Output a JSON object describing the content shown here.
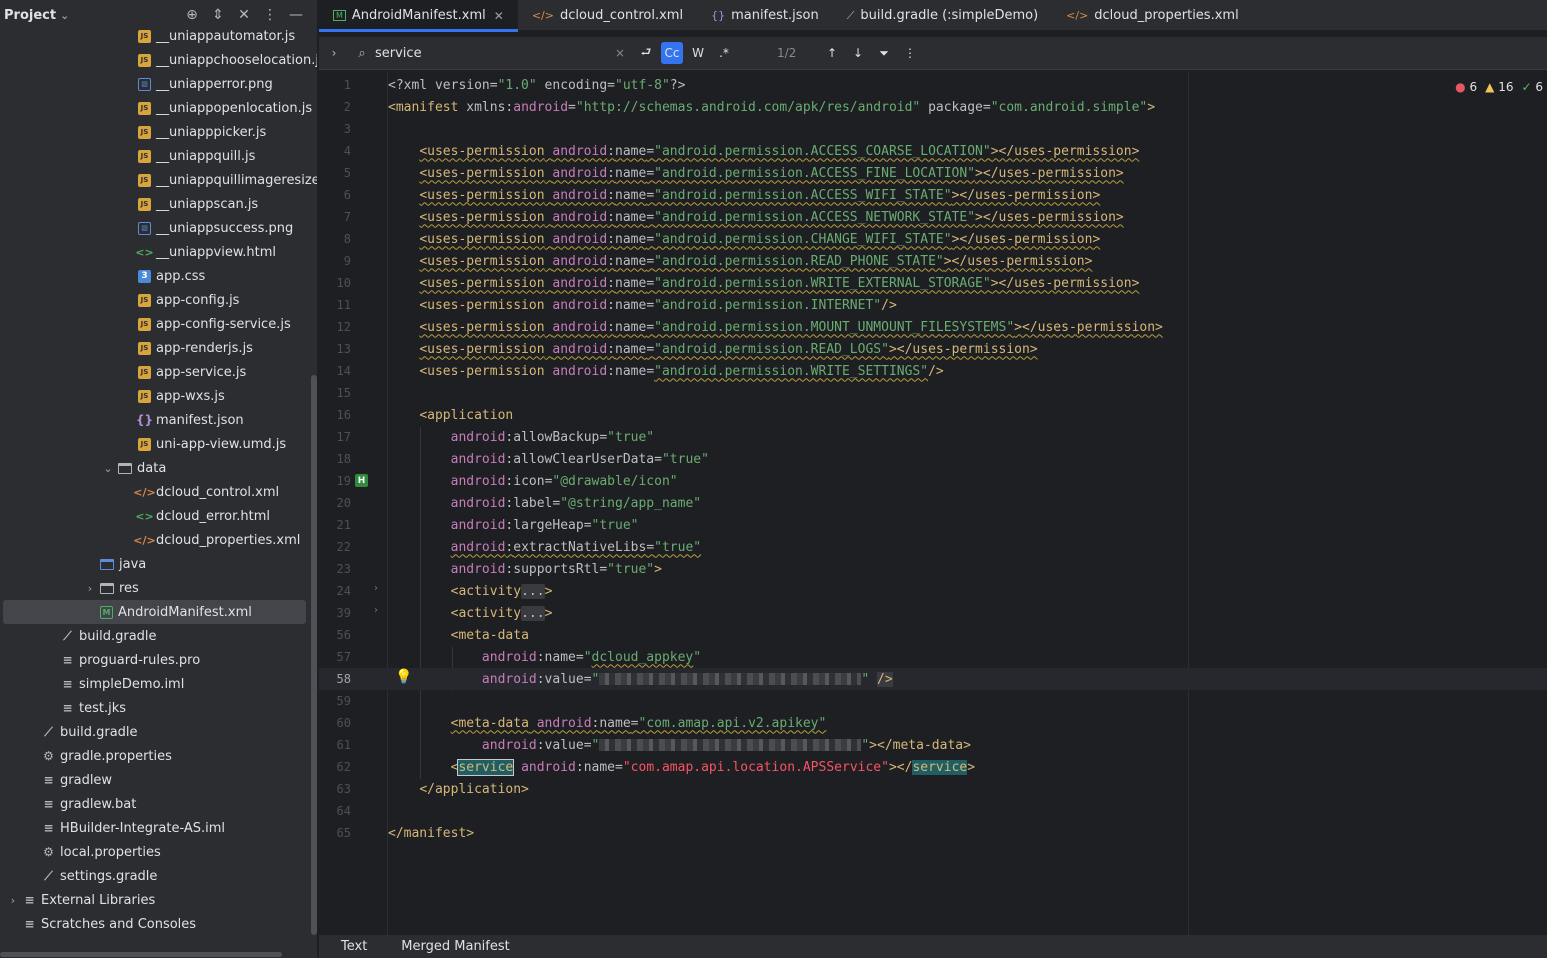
{
  "project": {
    "title": "Project",
    "tools": [
      "⊕",
      "⇕",
      "✕",
      "⋮",
      "—"
    ],
    "tree": [
      {
        "label": "__uniappautomator.js",
        "icon": "js",
        "indent": 138
      },
      {
        "label": "__uniappchooselocation.js",
        "icon": "js",
        "indent": 138
      },
      {
        "label": "__uniapperror.png",
        "icon": "png",
        "indent": 138
      },
      {
        "label": "__uniappopenlocation.js",
        "icon": "js",
        "indent": 138
      },
      {
        "label": "__uniapppicker.js",
        "icon": "js",
        "indent": 138
      },
      {
        "label": "__uniappquill.js",
        "icon": "js",
        "indent": 138
      },
      {
        "label": "__uniappquillimageresize.js",
        "icon": "js",
        "indent": 138
      },
      {
        "label": "__uniappscan.js",
        "icon": "js",
        "indent": 138
      },
      {
        "label": "__uniappsuccess.png",
        "icon": "png",
        "indent": 138
      },
      {
        "label": "__uniappview.html",
        "icon": "html",
        "indent": 138
      },
      {
        "label": "app.css",
        "icon": "css",
        "indent": 138
      },
      {
        "label": "app-config.js",
        "icon": "js",
        "indent": 138
      },
      {
        "label": "app-config-service.js",
        "icon": "js",
        "indent": 138
      },
      {
        "label": "app-renderjs.js",
        "icon": "js",
        "indent": 138
      },
      {
        "label": "app-service.js",
        "icon": "js",
        "indent": 138
      },
      {
        "label": "app-wxs.js",
        "icon": "js",
        "indent": 138
      },
      {
        "label": "manifest.json",
        "icon": "json",
        "indent": 138
      },
      {
        "label": "uni-app-view.umd.js",
        "icon": "js",
        "indent": 138
      },
      {
        "label": "data",
        "icon": "folder",
        "indent": 118,
        "arrow": "⌄"
      },
      {
        "label": "dcloud_control.xml",
        "icon": "xml",
        "indent": 138
      },
      {
        "label": "dcloud_error.html",
        "icon": "html",
        "indent": 138
      },
      {
        "label": "dcloud_properties.xml",
        "icon": "xml",
        "indent": 138
      },
      {
        "label": "java",
        "icon": "folder-blue",
        "indent": 100
      },
      {
        "label": "res",
        "icon": "folder",
        "indent": 100,
        "arrow": "›"
      },
      {
        "label": "AndroidManifest.xml",
        "icon": "manifest",
        "indent": 100,
        "selected": true
      },
      {
        "label": "build.gradle",
        "icon": "gradle",
        "indent": 61
      },
      {
        "label": "proguard-rules.pro",
        "icon": "text",
        "indent": 61
      },
      {
        "label": "simpleDemo.iml",
        "icon": "text",
        "indent": 61
      },
      {
        "label": "test.jks",
        "icon": "text",
        "indent": 61
      },
      {
        "label": "build.gradle",
        "icon": "gradle",
        "indent": 42
      },
      {
        "label": "gradle.properties",
        "icon": "gear",
        "indent": 42
      },
      {
        "label": "gradlew",
        "icon": "text",
        "indent": 42
      },
      {
        "label": "gradlew.bat",
        "icon": "text",
        "indent": 42
      },
      {
        "label": "HBuilder-Integrate-AS.iml",
        "icon": "text",
        "indent": 42
      },
      {
        "label": "local.properties",
        "icon": "gear",
        "indent": 42
      },
      {
        "label": "settings.gradle",
        "icon": "gradle",
        "indent": 42
      },
      {
        "label": "External Libraries",
        "icon": "text",
        "indent": 23,
        "arrow": "›"
      },
      {
        "label": "Scratches and Consoles",
        "icon": "text",
        "indent": 23
      }
    ]
  },
  "tabs": [
    {
      "label": "AndroidManifest.xml",
      "icon": "M",
      "active": true,
      "close": "✕"
    },
    {
      "label": "dcloud_control.xml",
      "icon": "</>"
    },
    {
      "label": "manifest.json",
      "icon": "{}"
    },
    {
      "label": "build.gradle (:simpleDemo)",
      "icon": "⟋"
    },
    {
      "label": "dcloud_properties.xml",
      "icon": "</>"
    }
  ],
  "find": {
    "query": "service",
    "placeholder": "",
    "match_case": "Cc",
    "words": "W",
    "regex": ".*",
    "count": "1/2"
  },
  "inspections": {
    "errors": "6",
    "warnings": "16",
    "ok": "6"
  },
  "code_lines": [
    {
      "n": "1",
      "html": "<span class='t-plain'>&lt;?xml version=</span><span class='t-val'>\"1.0\"</span><span class='t-plain'> encoding=</span><span class='t-val'>\"utf-8\"</span><span class='t-plain'>?&gt;</span>"
    },
    {
      "n": "2",
      "html": "<span class='t-tag'>&lt;manifest</span> <span class='t-plain'>xmlns:</span><span class='t-attrns'>android</span><span class='t-plain'>=</span><span class='t-val'>\"http://schemas.android.com/apk/res/android\"</span> <span class='t-plain'>package=</span><span class='t-val'>\"com.android.simple\"</span><span class='t-tag'>&gt;</span>"
    },
    {
      "n": "3",
      "html": ""
    },
    {
      "n": "4",
      "html": "    <span class='squig'><span class='t-tag'>&lt;uses-permission</span> <span class='t-attrns'>android</span>:<span class='t-attr'>name</span>=<span class='t-val'>\"android.permission.ACCESS_COARSE_LOCATION\"</span><span class='t-tag'>&gt;&lt;/uses-permission&gt;</span></span>"
    },
    {
      "n": "5",
      "html": "    <span class='squig'><span class='t-tag'>&lt;uses-permission</span> <span class='t-attrns'>android</span>:<span class='t-attr'>name</span>=<span class='t-val'>\"android.permission.ACCESS_FINE_LOCATION\"</span><span class='t-tag'>&gt;&lt;/uses-permission&gt;</span></span>"
    },
    {
      "n": "6",
      "html": "    <span class='squig'><span class='t-tag'>&lt;uses-permission</span> <span class='t-attrns'>android</span>:<span class='t-attr'>name</span>=<span class='t-val'>\"android.permission.ACCESS_WIFI_STATE\"</span><span class='t-tag'>&gt;&lt;/uses-permission&gt;</span></span>"
    },
    {
      "n": "7",
      "html": "    <span class='squig'><span class='t-tag'>&lt;uses-permission</span> <span class='t-attrns'>android</span>:<span class='t-attr'>name</span>=<span class='t-val'>\"android.permission.ACCESS_NETWORK_STATE\"</span><span class='t-tag'>&gt;&lt;/uses-permission&gt;</span></span>"
    },
    {
      "n": "8",
      "html": "    <span class='squig'><span class='t-tag'>&lt;uses-permission</span> <span class='t-attrns'>android</span>:<span class='t-attr'>name</span>=<span class='t-val'>\"android.permission.CHANGE_WIFI_STATE\"</span><span class='t-tag'>&gt;&lt;/uses-permission&gt;</span></span>"
    },
    {
      "n": "9",
      "html": "    <span class='squig'><span class='t-tag'>&lt;uses-permission</span> <span class='t-attrns'>android</span>:<span class='t-attr'>name</span>=<span class='t-val'>\"android.permission.READ_PHONE_STATE\"</span><span class='t-tag'>&gt;&lt;/uses-permission&gt;</span></span>"
    },
    {
      "n": "10",
      "html": "    <span class='squig'><span class='t-tag'>&lt;uses-permission</span> <span class='t-attrns'>android</span>:<span class='t-attr'>name</span>=<span class='t-val'>\"android.permission.WRITE_EXTERNAL_STORAGE\"</span><span class='t-tag'>&gt;&lt;/uses-permission&gt;</span></span>"
    },
    {
      "n": "11",
      "html": "    <span class='t-tag'>&lt;uses-permission</span> <span class='t-attrns'>android</span>:<span class='t-attr'>name</span>=<span class='t-val'>\"android.permission.INTERNET\"</span><span class='t-tag'>/&gt;</span>"
    },
    {
      "n": "12",
      "html": "    <span class='squig'><span class='t-tag'>&lt;uses-permission</span> <span class='t-attrns'>android</span>:<span class='t-attr'>name</span>=<span class='t-val'>\"android.permission.MOUNT_UNMOUNT_FILESYSTEMS\"</span><span class='t-tag'>&gt;&lt;/uses-permission&gt;</span></span>"
    },
    {
      "n": "13",
      "html": "    <span class='squig'><span class='t-tag'>&lt;uses-permission</span> <span class='t-attrns'>android</span>:<span class='t-attr'>name</span>=<span class='t-val'>\"android.permission.READ_LOGS\"</span><span class='t-tag'>&gt;&lt;/uses-permission&gt;</span></span>"
    },
    {
      "n": "14",
      "html": "    <span class='t-tag'>&lt;uses-permission</span> <span class='t-attrns'>android</span>:<span class='t-attr'>name</span>=<span class='t-val squig'>\"android.permission.WRITE_SETTINGS\"</span><span class='t-tag'>/&gt;</span>"
    },
    {
      "n": "15",
      "html": ""
    },
    {
      "n": "16",
      "html": "    <span class='t-tag'>&lt;application</span>"
    },
    {
      "n": "17",
      "html": "        <span class='t-attrns'>android</span>:<span class='t-attr'>allowBackup</span>=<span class='t-val'>\"true\"</span>"
    },
    {
      "n": "18",
      "html": "        <span class='t-attrns'>android</span>:<span class='t-attr'>allowClearUserData</span>=<span class='t-val'>\"true\"</span>"
    },
    {
      "n": "19",
      "html": "        <span class='t-attrns'>android</span>:<span class='t-attr'>icon</span>=<span class='t-val'>\"@drawable/icon\"</span>",
      "badge": "H"
    },
    {
      "n": "20",
      "html": "        <span class='t-attrns'>android</span>:<span class='t-attr'>label</span>=<span class='t-val'>\"@string/app_name\"</span>"
    },
    {
      "n": "21",
      "html": "        <span class='t-attrns'>android</span>:<span class='t-attr'>largeHeap</span>=<span class='t-val'>\"true\"</span>"
    },
    {
      "n": "22",
      "html": "        <span class='squig'><span class='t-attrns'>android</span>:<span class='t-attr'>extractNativeLibs</span>=<span class='t-val'>\"true\"</span></span>"
    },
    {
      "n": "23",
      "html": "        <span class='t-attrns'>android</span>:<span class='t-attr'>supportsRtl</span>=<span class='t-val'>\"true\"</span><span class='t-tag'>&gt;</span>"
    },
    {
      "n": "24",
      "html": "        <span class='t-tag'>&lt;activity</span><span class='fold'>...</span><span class='t-tag'>&gt;</span>",
      "fold": "›"
    },
    {
      "n": "39",
      "html": "        <span class='t-tag'>&lt;activity</span><span class='fold'>...</span><span class='t-tag'>&gt;</span>",
      "fold": "›"
    },
    {
      "n": "56",
      "html": "        <span class='t-tag'>&lt;meta-data</span>"
    },
    {
      "n": "57",
      "html": "            <span class='t-attrns'>android</span>:<span class='t-attr'>name</span>=<span class='t-val'>\"<span class='squig'>dcloud_appkey</span>\"</span>"
    },
    {
      "n": "58",
      "html": "            <span class='t-attrns'>android</span>:<span class='t-attr'>value</span>=<span class='t-val'>\"<span class='blur' style='width:262px'></span>\"</span> <span class='t-tag' style='background:#393b40'>/&gt;</span>",
      "current": true,
      "bulb": "💡"
    },
    {
      "n": "59",
      "html": ""
    },
    {
      "n": "60",
      "html": "        <span class='squig'><span class='t-tag'>&lt;meta-data</span> <span class='t-attrns'>android</span>:<span class='t-attr'>name</span>=<span class='t-val'>\"com.amap.api.v2.apikey\"</span></span>"
    },
    {
      "n": "61",
      "html": "            <span class='t-attrns'>android</span>:<span class='t-attr'>value</span>=<span class='t-val'>\"<span class='blur' style='width:262px'></span>\"</span><span class='t-tag'>&gt;&lt;/meta-data&gt;</span>"
    },
    {
      "n": "62",
      "html": "        <span class='t-tag'>&lt;</span><span class='t-tag hit-box'>service</span> <span class='t-attrns'>android</span>:<span class='t-attr'>name</span>=<span class='t-val t-red'>\"com.amap.api.location.APSService\"</span><span class='t-tag'>&gt;&lt;/</span><span class='t-tag hit'>service</span><span class='t-tag'>&gt;</span>"
    },
    {
      "n": "63",
      "html": "    <span class='t-tag'>&lt;/application&gt;</span>"
    },
    {
      "n": "64",
      "html": ""
    },
    {
      "n": "65",
      "html": "<span class='t-tag'>&lt;/manifest&gt;</span>"
    }
  ],
  "bottom_tabs": [
    "Text",
    "Merged Manifest"
  ]
}
